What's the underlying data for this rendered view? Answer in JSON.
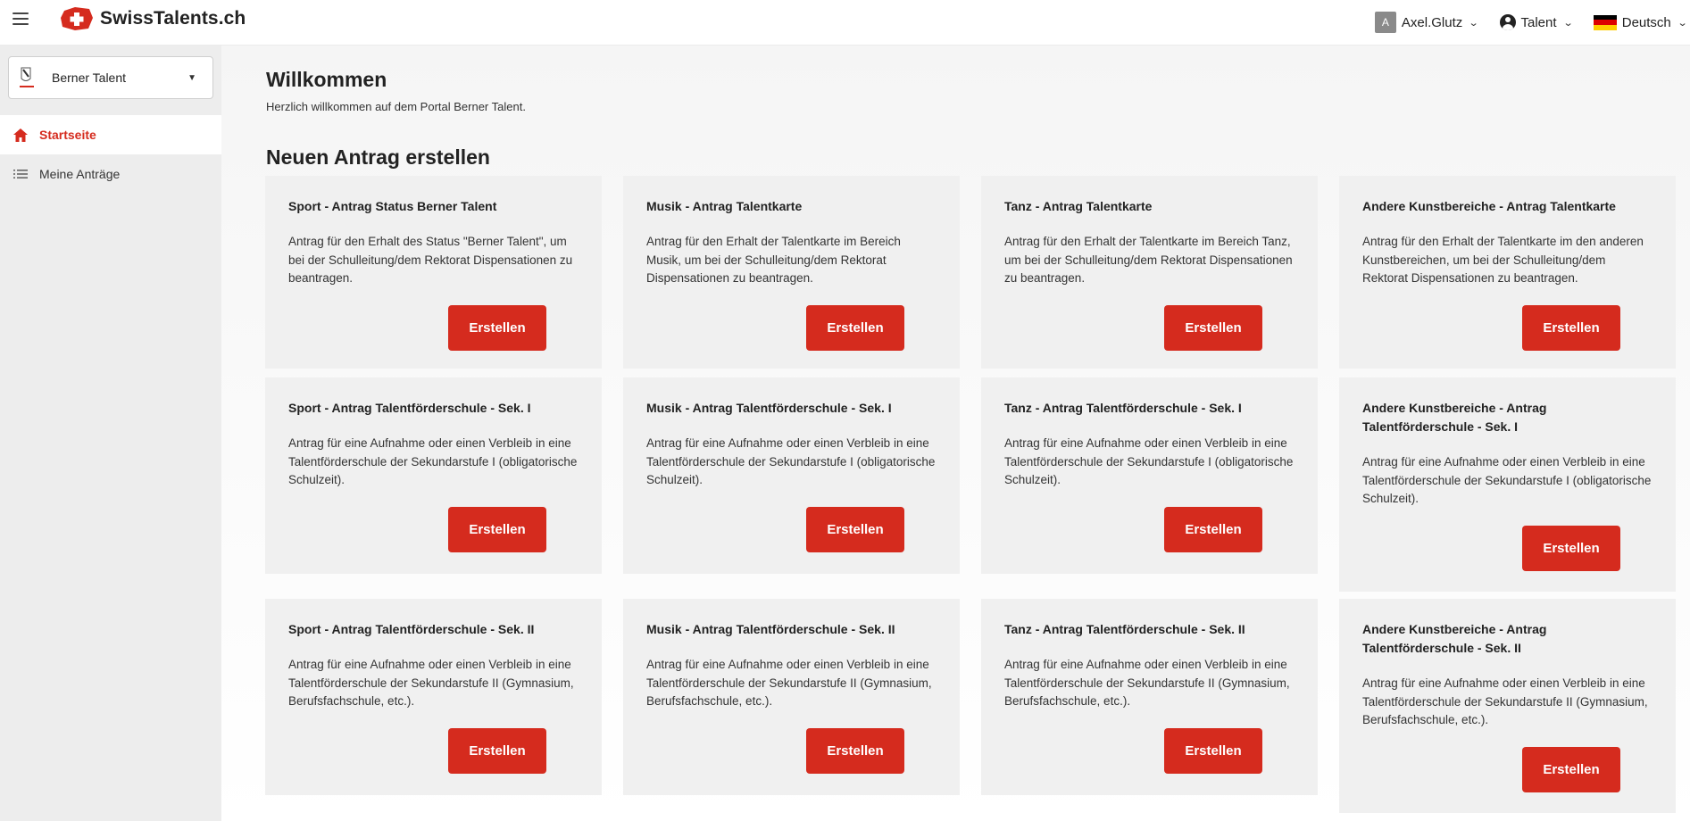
{
  "header": {
    "brand": "SwissTalents.ch",
    "user_initial": "A",
    "user_name": "Axel.Glutz",
    "role": "Talent",
    "language": "Deutsch"
  },
  "colors": {
    "accent": "#d52b1e",
    "sidebar_bg": "#ededed",
    "card_bg": "#f0f0f0"
  },
  "sidebar": {
    "org_name": "Berner Talent",
    "items": [
      {
        "label": "Startseite",
        "icon": "home-icon",
        "active": true
      },
      {
        "label": "Meine Anträge",
        "icon": "list-icon",
        "active": false
      }
    ]
  },
  "main": {
    "welcome_title": "Willkommen",
    "welcome_text": "Herzlich willkommen auf dem Portal Berner Talent.",
    "section_title": "Neuen Antrag erstellen",
    "button_label": "Erstellen",
    "cards": [
      {
        "title": "Sport - Antrag Status Berner Talent",
        "desc": "Antrag für den Erhalt des Status \"Berner Talent\", um bei der Schulleitung/dem Rektorat Dispensationen zu beantragen."
      },
      {
        "title": "Musik - Antrag Talentkarte",
        "desc": "Antrag für den Erhalt der Talentkarte im Bereich Musik, um bei der Schulleitung/dem Rektorat Dispensationen zu beantragen."
      },
      {
        "title": "Tanz - Antrag Talentkarte",
        "desc": "Antrag für den Erhalt der Talentkarte im Bereich Tanz, um bei der Schulleitung/dem Rektorat Dispensationen zu beantragen."
      },
      {
        "title": "Andere Kunstbereiche - Antrag Talentkarte",
        "desc": "Antrag für den Erhalt der Talentkarte im den anderen Kunstbereichen, um bei der Schulleitung/dem Rektorat Dispensationen zu beantragen."
      },
      {
        "title": "Sport - Antrag Talentförderschule - Sek. I",
        "desc": "Antrag für eine Aufnahme oder einen Verbleib in eine Talentförderschule der Sekundarstufe I (obligatorische Schulzeit)."
      },
      {
        "title": "Musik - Antrag Talentförderschule - Sek. I",
        "desc": "Antrag für eine Aufnahme oder einen Verbleib in eine Talentförderschule der Sekundarstufe I (obligatorische Schulzeit)."
      },
      {
        "title": "Tanz - Antrag Talentförderschule - Sek. I",
        "desc": "Antrag für eine Aufnahme oder einen Verbleib in eine Talentförderschule der Sekundarstufe I (obligatorische Schulzeit)."
      },
      {
        "title": "Andere Kunstbereiche - Antrag Talentförderschule - Sek. I",
        "desc": "Antrag für eine Aufnahme oder einen Verbleib in eine Talentförderschule der Sekundarstufe I (obligatorische Schulzeit)."
      },
      {
        "title": "Sport - Antrag Talentförderschule - Sek. II",
        "desc": "Antrag für eine Aufnahme oder einen Verbleib in eine Talentförderschule der Sekundarstufe II (Gymnasium, Berufsfachschule, etc.)."
      },
      {
        "title": "Musik - Antrag Talentförderschule - Sek. II",
        "desc": "Antrag für eine Aufnahme oder einen Verbleib in eine Talentförderschule der Sekundarstufe II (Gymnasium, Berufsfachschule, etc.)."
      },
      {
        "title": "Tanz - Antrag Talentförderschule - Sek. II",
        "desc": "Antrag für eine Aufnahme oder einen Verbleib in eine Talentförderschule der Sekundarstufe II (Gymnasium, Berufsfachschule, etc.)."
      },
      {
        "title": "Andere Kunstbereiche - Antrag Talentförderschule - Sek. II",
        "desc": "Antrag für eine Aufnahme oder einen Verbleib in eine Talentförderschule der Sekundarstufe II (Gymnasium, Berufsfachschule, etc.)."
      }
    ]
  }
}
